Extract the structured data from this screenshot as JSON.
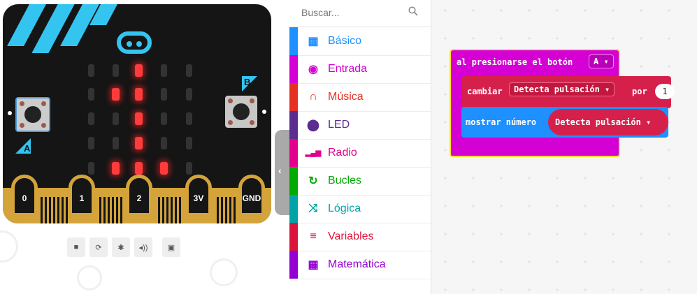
{
  "simulator": {
    "pins": [
      "0",
      "1",
      "2",
      "3V",
      "GND"
    ],
    "button_a_label": "A",
    "button_b_label": "B",
    "led_matrix": [
      [
        0,
        0,
        1,
        0,
        0
      ],
      [
        0,
        1,
        1,
        0,
        0
      ],
      [
        0,
        0,
        1,
        0,
        0
      ],
      [
        0,
        0,
        1,
        0,
        0
      ],
      [
        0,
        1,
        1,
        1,
        0
      ]
    ],
    "controls": [
      "stop-icon",
      "restart-icon",
      "debug-icon",
      "mute-icon",
      "fullscreen-icon"
    ]
  },
  "toolbox": {
    "search_placeholder": "Buscar...",
    "categories": [
      {
        "label": "Básico",
        "color": "#1e90ff",
        "icon": "grid-icon"
      },
      {
        "label": "Entrada",
        "color": "#d400d4",
        "icon": "radio-button-icon"
      },
      {
        "label": "Música",
        "color": "#e63022",
        "icon": "headphones-icon"
      },
      {
        "label": "LED",
        "color": "#5c2d91",
        "icon": "toggle-icon"
      },
      {
        "label": "Radio",
        "color": "#e3008c",
        "icon": "signal-bars-icon"
      },
      {
        "label": "Bucles",
        "color": "#00aa00",
        "icon": "refresh-icon"
      },
      {
        "label": "Lógica",
        "color": "#00a4a6",
        "icon": "shuffle-icon"
      },
      {
        "label": "Variables",
        "color": "#dc143c",
        "icon": "list-icon"
      },
      {
        "label": "Matemática",
        "color": "#9400d3",
        "icon": "calculator-icon"
      }
    ]
  },
  "workspace": {
    "event_block": {
      "label": "al presionarse el botón",
      "button": "A ▾"
    },
    "change_block": {
      "label": "cambiar",
      "variable": "Detecta pulsación ▾",
      "by_label": "por",
      "value": "1"
    },
    "show_block": {
      "label": "mostrar número",
      "variable": "Detecta pulsación ▾"
    }
  },
  "colors": {
    "accent": "#33c5f0",
    "board": "#151515",
    "gold": "#d4a43a",
    "input": "#d400d4",
    "variables": "#d6204c",
    "basic": "#1e90ff"
  }
}
